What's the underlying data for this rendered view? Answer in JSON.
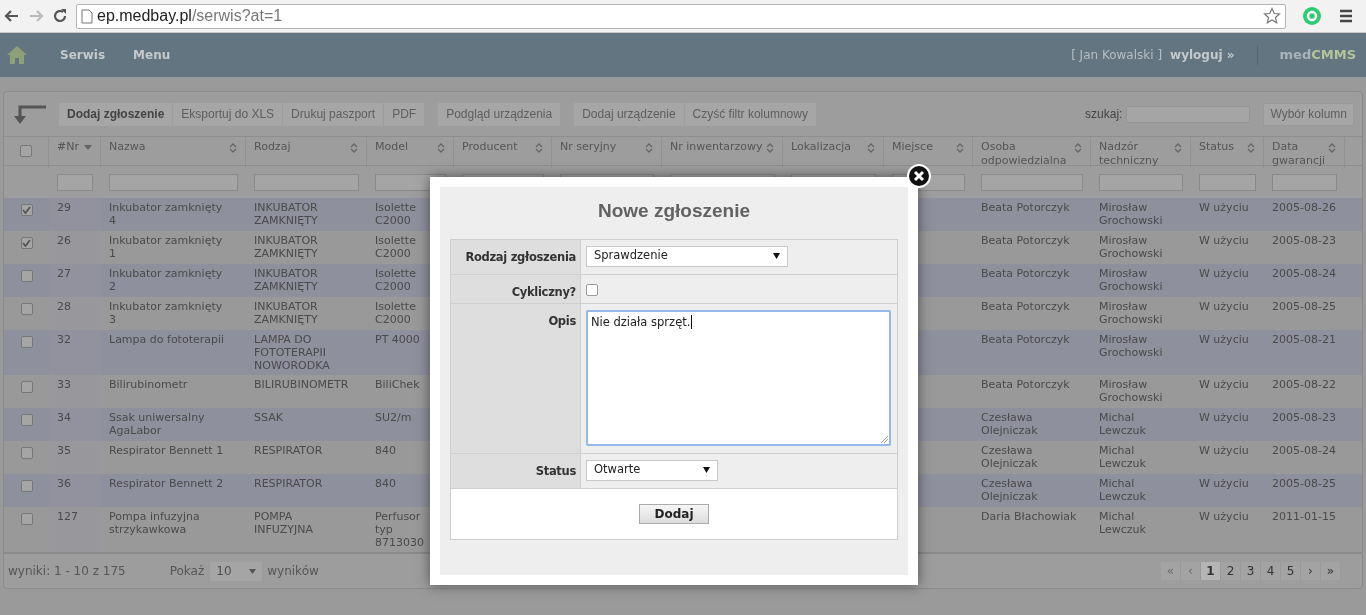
{
  "browser": {
    "url_host": "ep.medbay.pl",
    "url_path": "/serwis?at=1"
  },
  "navbar": {
    "items": [
      "Serwis",
      "Menu"
    ],
    "user": "[ Jan Kowalski ]",
    "logout": "wyloguj »",
    "brand_a": "med",
    "brand_b": "CMMS"
  },
  "toolbar": {
    "groups": [
      [
        "Dodaj zgłoszenie",
        "Eksportuj do XLS",
        "Drukuj paszport",
        "PDF"
      ],
      [
        "Podgląd urządzenia"
      ],
      [
        "Dodaj urządzenie",
        "Czyść filtr kolumnowy"
      ]
    ],
    "search_label": "szukaj:",
    "columns_button": "Wybór kolumn"
  },
  "table": {
    "select_all_checked": false,
    "columns": [
      {
        "label": "#Nr",
        "sorted": true
      },
      {
        "label": "Nazwa",
        "sorted": false
      },
      {
        "label": "Rodzaj",
        "sorted": false
      },
      {
        "label": "Model",
        "sorted": false
      },
      {
        "label": "Producent",
        "sorted": false
      },
      {
        "label": "Nr seryjny",
        "sorted": false
      },
      {
        "label": "Nr inwentarzowy",
        "sorted": false
      },
      {
        "label": "Lokalizacja",
        "sorted": false
      },
      {
        "label": "Miejsce",
        "sorted": false
      },
      {
        "label": "Osoba odpowiedzialna",
        "sorted": false
      },
      {
        "label": "Nadzór techniczny",
        "sorted": false
      },
      {
        "label": "Status",
        "sorted": false
      },
      {
        "label": "Data gwarancji",
        "sorted": false
      }
    ],
    "rows": [
      {
        "checked": true,
        "nr": "29",
        "name": "Inkubator zamknięty 4",
        "type": "INKUBATOR ZAMKNIĘTY",
        "model": "Isolette C2000",
        "person": "Beata Potorczyk",
        "supervisor": "Mirosław Grochowski",
        "status": "W użyciu",
        "warranty": "2005-08-26"
      },
      {
        "checked": true,
        "nr": "26",
        "name": "Inkubator zamknięty 1",
        "type": "INKUBATOR ZAMKNIĘTY",
        "model": "Isolette C2000",
        "person": "Beata Potorczyk",
        "supervisor": "Mirosław Grochowski",
        "status": "W użyciu",
        "warranty": "2005-08-23"
      },
      {
        "checked": false,
        "nr": "27",
        "name": "Inkubator zamknięty 2",
        "type": "INKUBATOR ZAMKNIĘTY",
        "model": "Isolette C2000",
        "person": "Beata Potorczyk",
        "supervisor": "Mirosław Grochowski",
        "status": "W użyciu",
        "warranty": "2005-08-24"
      },
      {
        "checked": false,
        "nr": "28",
        "name": "Inkubator zamknięty 3",
        "type": "INKUBATOR ZAMKNIĘTY",
        "model": "Isolette C2000",
        "person": "Beata Potorczyk",
        "supervisor": "Mirosław Grochowski",
        "status": "W użyciu",
        "warranty": "2005-08-25"
      },
      {
        "checked": false,
        "nr": "32",
        "name": "Lampa do fototerapii",
        "type": "LAMPA DO FOTOTERAPII NOWORODKA",
        "model": "PT 4000",
        "person": "Beata Potorczyk",
        "supervisor": "Mirosław Grochowski",
        "status": "W użyciu",
        "warranty": "2005-08-21"
      },
      {
        "checked": false,
        "nr": "33",
        "name": "Bilirubinometr",
        "type": "BILIRUBINOMETR",
        "model": "BiliChek",
        "person": "Beata Potorczyk",
        "supervisor": "Mirosław Grochowski",
        "status": "W użyciu",
        "warranty": "2005-08-22"
      },
      {
        "checked": false,
        "nr": "34",
        "name": "Ssak uniwersalny AgaLabor",
        "type": "SSAK",
        "model": "SU2/m",
        "person": "Czesława Olejniczak",
        "supervisor": "Michal Lewczuk",
        "status": "W użyciu",
        "warranty": "2005-08-23"
      },
      {
        "checked": false,
        "nr": "35",
        "name": "Respirator Bennett 1",
        "type": "RESPIRATOR",
        "model": "840",
        "person": "Czesława Olejniczak",
        "supervisor": "Michal Lewczuk",
        "status": "W użyciu",
        "warranty": "2005-08-24"
      },
      {
        "checked": false,
        "nr": "36",
        "name": "Respirator Bennett 2",
        "type": "RESPIRATOR",
        "model": "840",
        "person": "Czesława Olejniczak",
        "supervisor": "Michal Lewczuk",
        "status": "W użyciu",
        "warranty": "2005-08-25"
      },
      {
        "checked": false,
        "nr": "127",
        "name": "Pompa infuzyjna strzykawkowa",
        "type": "POMPA INFUZYJNA",
        "model": "Perfusor typ 8713030",
        "person": "Daria Błachowiak",
        "supervisor": "Michal Lewczuk",
        "status": "W użyciu",
        "warranty": "2011-01-15"
      }
    ]
  },
  "footer": {
    "results": "wyniki: 1 - 10 z 175",
    "show_label": "Pokaż",
    "page_size": "10",
    "show_suffix": "wyników",
    "pages": [
      {
        "label": "«",
        "disabled": true,
        "selected": false
      },
      {
        "label": "‹",
        "disabled": true,
        "selected": false
      },
      {
        "label": "1",
        "disabled": false,
        "selected": true
      },
      {
        "label": "2",
        "disabled": false,
        "selected": false
      },
      {
        "label": "3",
        "disabled": false,
        "selected": false
      },
      {
        "label": "4",
        "disabled": false,
        "selected": false
      },
      {
        "label": "5",
        "disabled": false,
        "selected": false
      },
      {
        "label": "›",
        "disabled": false,
        "selected": false
      },
      {
        "label": "»",
        "disabled": false,
        "selected": false
      }
    ]
  },
  "dialog": {
    "title": "Nowe zgłoszenie",
    "fields": [
      {
        "kind": "select",
        "label": "Rodzaj zgłoszenia",
        "value": "Sprawdzenie"
      },
      {
        "kind": "checkbox",
        "label": "Cykliczny?",
        "checked": false
      },
      {
        "kind": "textarea",
        "label": "Opis",
        "value": "Nie działa sprzęt."
      },
      {
        "kind": "select",
        "label": "Status",
        "value": "Otwarte"
      }
    ],
    "submit": "Dodaj"
  }
}
